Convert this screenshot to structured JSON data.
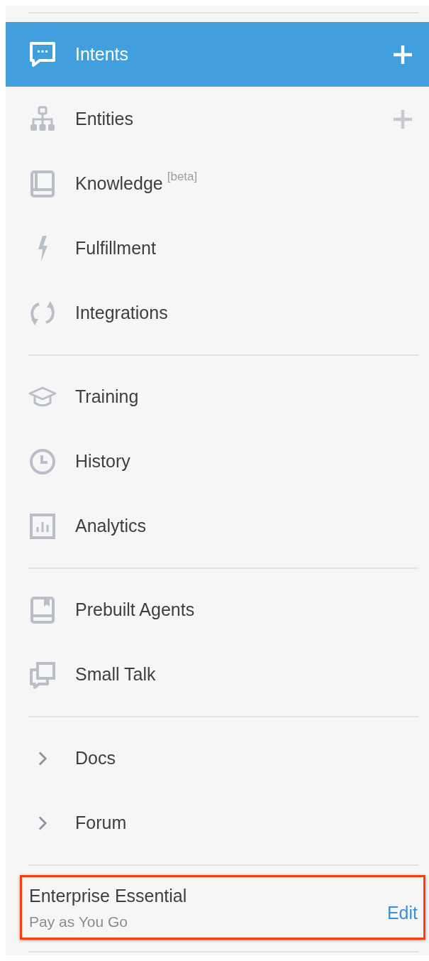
{
  "sidebar": {
    "sections": [
      {
        "items": [
          {
            "label": "Intents",
            "selected": true,
            "add": true
          },
          {
            "label": "Entities",
            "selected": false,
            "add": true
          },
          {
            "label": "Knowledge",
            "badge": "[beta]",
            "selected": false
          },
          {
            "label": "Fulfillment",
            "selected": false
          },
          {
            "label": "Integrations",
            "selected": false
          }
        ]
      },
      {
        "items": [
          {
            "label": "Training",
            "selected": false
          },
          {
            "label": "History",
            "selected": false
          },
          {
            "label": "Analytics",
            "selected": false
          }
        ]
      },
      {
        "items": [
          {
            "label": "Prebuilt Agents",
            "selected": false
          },
          {
            "label": "Small Talk",
            "selected": false
          }
        ]
      },
      {
        "items": [
          {
            "label": "Docs",
            "selected": false
          },
          {
            "label": "Forum",
            "selected": false
          }
        ]
      }
    ],
    "plan": {
      "name": "Enterprise Essential",
      "billing": "Pay as You Go",
      "action": "Edit",
      "highlighted": true
    }
  }
}
